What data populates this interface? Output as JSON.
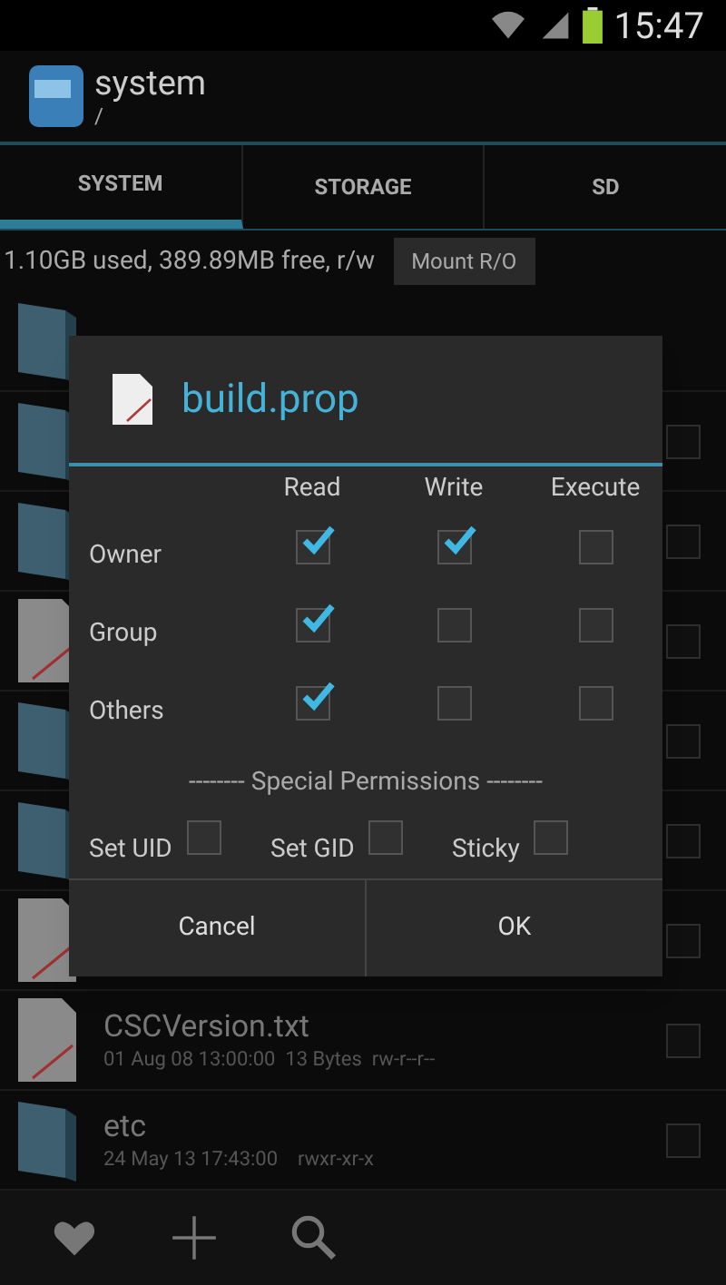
{
  "status_bar": {
    "time": "15:47"
  },
  "action_bar": {
    "title": "system",
    "subtitle": "/"
  },
  "tabs": [
    {
      "label": "SYSTEM",
      "selected": true
    },
    {
      "label": "STORAGE",
      "selected": false
    },
    {
      "label": "SD",
      "selected": false
    }
  ],
  "storage_info": {
    "text": "1.10GB used, 389.89MB free, r/w",
    "button": "Mount R/O"
  },
  "files": [
    {
      "kind": "parent"
    },
    {
      "kind": "folder",
      "checked": false
    },
    {
      "kind": "folder",
      "checked": false
    },
    {
      "kind": "file",
      "checked": false
    },
    {
      "kind": "folder",
      "checked": false
    },
    {
      "kind": "folder",
      "checked": false
    },
    {
      "kind": "file",
      "checked": false
    },
    {
      "kind": "file",
      "name": "CSCVersion.txt",
      "meta": "01 Aug 08 13:00:00  13 Bytes  rw-r--r--",
      "checked": false
    },
    {
      "kind": "folder",
      "name": "etc",
      "meta": "24 May 13 17:43:00    rwxr-xr-x",
      "checked": false
    }
  ],
  "dialog": {
    "title": "build.prop",
    "columns": [
      "Read",
      "Write",
      "Execute"
    ],
    "rows": [
      {
        "label": "Owner",
        "checks": [
          true,
          true,
          false
        ]
      },
      {
        "label": "Group",
        "checks": [
          true,
          false,
          false
        ]
      },
      {
        "label": "Others",
        "checks": [
          true,
          false,
          false
        ]
      }
    ],
    "special_heading": "-------- Special Permissions --------",
    "special": [
      {
        "label": "Set UID",
        "checked": false
      },
      {
        "label": "Set GID",
        "checked": false
      },
      {
        "label": "Sticky",
        "checked": false
      }
    ],
    "buttons": [
      "Cancel",
      "OK"
    ]
  },
  "bottom_bar": [
    {
      "kind": "heart"
    },
    {
      "kind": "plus"
    },
    {
      "kind": "search"
    }
  ]
}
